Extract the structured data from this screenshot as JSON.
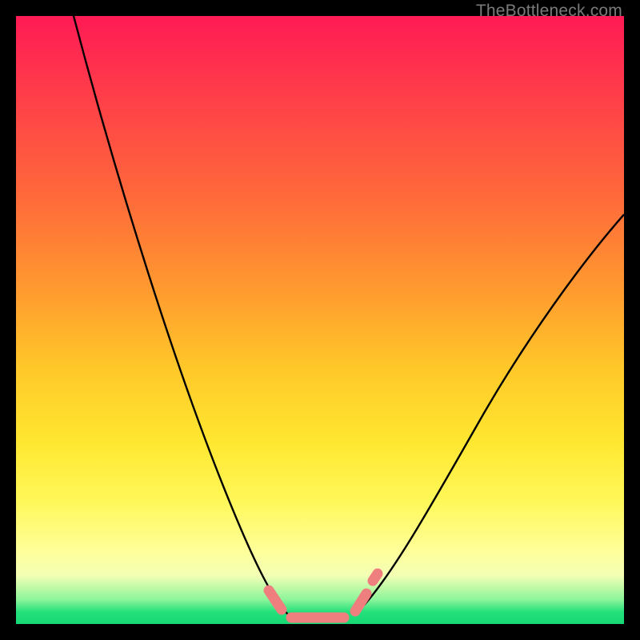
{
  "watermark": "TheBottleneck.com",
  "chart_data": {
    "type": "line",
    "title": "",
    "xlabel": "",
    "ylabel": "",
    "ylim": [
      0,
      100
    ],
    "xlim": [
      0,
      100
    ],
    "series": [
      {
        "name": "left-curve",
        "x": [
          10,
          15,
          20,
          25,
          30,
          35,
          40,
          43,
          45
        ],
        "values": [
          100,
          82,
          65,
          49,
          34,
          20,
          9,
          3,
          1
        ]
      },
      {
        "name": "right-curve",
        "x": [
          55,
          58,
          62,
          68,
          75,
          82,
          90,
          100
        ],
        "values": [
          2,
          5,
          12,
          23,
          36,
          48,
          58,
          68
        ]
      }
    ],
    "annotations": [
      {
        "name": "trough-marker",
        "x_range": [
          43,
          56
        ],
        "y": 1,
        "color": "#f08080"
      }
    ],
    "gradient_stops": [
      {
        "pct": 0,
        "color": "#ff1a55"
      },
      {
        "pct": 30,
        "color": "#ff6a3a"
      },
      {
        "pct": 58,
        "color": "#ffc829"
      },
      {
        "pct": 88,
        "color": "#ffff9a"
      },
      {
        "pct": 96,
        "color": "#8cf59a"
      },
      {
        "pct": 100,
        "color": "#16d874"
      }
    ]
  }
}
